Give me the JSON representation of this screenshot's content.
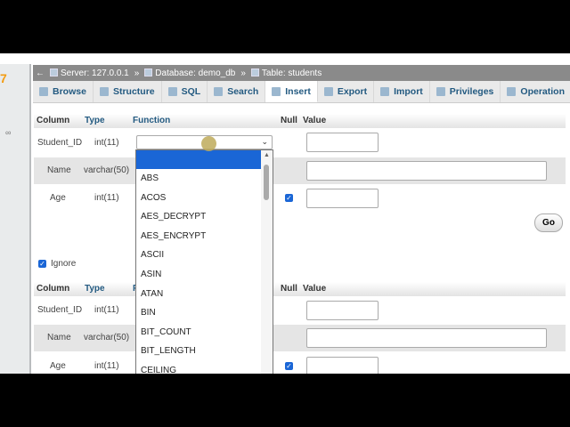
{
  "breadcrumb": {
    "server": "Server: 127.0.0.1",
    "database": "Database: demo_db",
    "table": "Table: students",
    "sep": "»"
  },
  "tabs": [
    {
      "label": "Browse"
    },
    {
      "label": "Structure"
    },
    {
      "label": "SQL"
    },
    {
      "label": "Search"
    },
    {
      "label": "Insert"
    },
    {
      "label": "Export"
    },
    {
      "label": "Import"
    },
    {
      "label": "Privileges"
    },
    {
      "label": "Operation"
    }
  ],
  "active_tab": "Insert",
  "headers": {
    "column": "Column",
    "type": "Type",
    "function": "Function",
    "null": "Null",
    "value": "Value",
    "function_short": "F"
  },
  "rows": [
    {
      "column": "Student_ID",
      "type": "int(11)"
    },
    {
      "column": "Name",
      "type": "varchar(50)"
    },
    {
      "column": "Age",
      "type": "int(11)"
    }
  ],
  "go_label": "Go",
  "ignore_label": "Ignore",
  "sidebar_logo": "7",
  "function_options": [
    "",
    "ABS",
    "ACOS",
    "AES_DECRYPT",
    "AES_ENCRYPT",
    "ASCII",
    "ASIN",
    "ATAN",
    "BIN",
    "BIT_COUNT",
    "BIT_LENGTH",
    "CEILING"
  ],
  "accent": "#1a66d6"
}
